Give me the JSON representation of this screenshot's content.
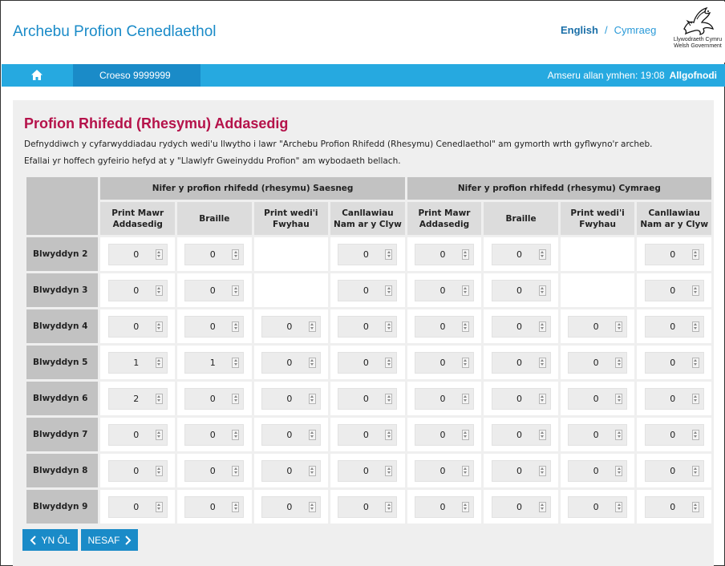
{
  "header": {
    "app_title": "Archebu Profion Cenedlaethol",
    "lang_english": "English",
    "lang_separator": "/",
    "lang_welsh": "Cymraeg",
    "logo_line1": "Llywodraeth Cymru",
    "logo_line2": "Welsh Government"
  },
  "navbar": {
    "home_icon": "home-icon",
    "welcome": "Croeso 9999999",
    "timeout": "Amseru allan ymhen: 19:08",
    "logout": "Allgofnodi"
  },
  "page": {
    "title": "Profion Rhifedd (Rhesymu) Addasedig",
    "intro1": "Defnyddiwch y cyfarwyddiadau rydych wedi'u llwytho i lawr \"Archebu Profion Rhifedd (Rhesymu) Cenedlaethol\" am gymorth wrth gyflwyno'r archeb.",
    "intro2": "Efallai yr hoffech gyfeirio hefyd at y \"Llawlyfr Gweinyddu Profion\" am wybodaeth bellach."
  },
  "table": {
    "group_english": "Nifer y profion rhifedd (rhesymu) Saesneg",
    "group_welsh": "Nifer y profion rhifedd (rhesymu) Cymraeg",
    "columns": [
      [
        "Print Mawr",
        "Addasedig"
      ],
      [
        "Braille"
      ],
      [
        "Print wedi'i",
        "Fwyhau"
      ],
      [
        "Canllawiau",
        "Nam ar y Clyw"
      ],
      [
        "Print Mawr",
        "Addasedig"
      ],
      [
        "Braille"
      ],
      [
        "Print wedi'i",
        "Fwyhau"
      ],
      [
        "Canllawiau",
        "Nam ar y Clyw"
      ]
    ],
    "rows": [
      {
        "label": "Blwyddyn 2",
        "values": [
          "0",
          "0",
          null,
          "0",
          "0",
          "0",
          null,
          "0"
        ]
      },
      {
        "label": "Blwyddyn 3",
        "values": [
          "0",
          "0",
          null,
          "0",
          "0",
          "0",
          null,
          "0"
        ]
      },
      {
        "label": "Blwyddyn 4",
        "values": [
          "0",
          "0",
          "0",
          "0",
          "0",
          "0",
          "0",
          "0"
        ]
      },
      {
        "label": "Blwyddyn 5",
        "values": [
          "1",
          "1",
          "0",
          "0",
          "0",
          "0",
          "0",
          "0"
        ]
      },
      {
        "label": "Blwyddyn 6",
        "values": [
          "2",
          "0",
          "0",
          "0",
          "0",
          "0",
          "0",
          "0"
        ]
      },
      {
        "label": "Blwyddyn 7",
        "values": [
          "0",
          "0",
          "0",
          "0",
          "0",
          "0",
          "0",
          "0"
        ]
      },
      {
        "label": "Blwyddyn 8",
        "values": [
          "0",
          "0",
          "0",
          "0",
          "0",
          "0",
          "0",
          "0"
        ]
      },
      {
        "label": "Blwyddyn 9",
        "values": [
          "0",
          "0",
          "0",
          "0",
          "0",
          "0",
          "0",
          "0"
        ]
      }
    ]
  },
  "buttons": {
    "back": "YN ÔL",
    "next": "NESAF"
  },
  "colors": {
    "accent": "#26a9e0",
    "accent_dark": "#1a8bc8",
    "title": "#b5124a"
  }
}
